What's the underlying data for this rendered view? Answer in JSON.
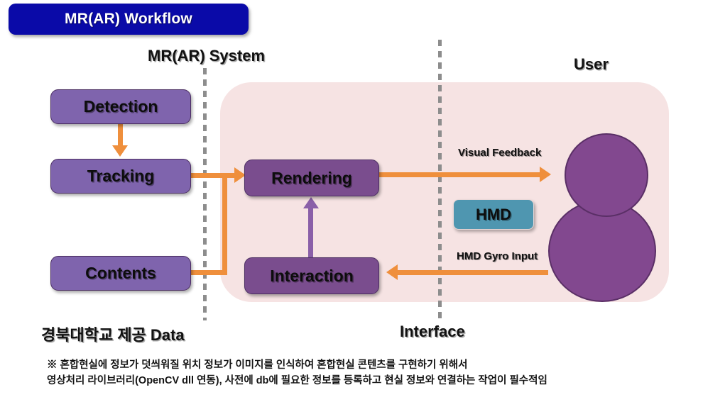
{
  "title": {
    "text": "MR(AR) Workflow",
    "background_color": "#0a0aa8",
    "text_color": "#ffffff"
  },
  "captions": {
    "system": "MR(AR) System",
    "user": "User",
    "data_source": "경북대학교 제공 Data",
    "interface": "Interface"
  },
  "colors": {
    "accent_orange": "#ef8f3c",
    "accent_purple_arrow": "#8a5fa8",
    "box_light_purple": "#7f64ad",
    "box_dark_purple": "#7a4d8e",
    "panel_pink": "#f6e3e3",
    "avatar_purple": "#82488f",
    "hmd_teal": "#4f96b0",
    "divider_gray": "#8d8d8d"
  },
  "boxes": {
    "detection": "Detection",
    "tracking": "Tracking",
    "contents": "Contents",
    "rendering": "Rendering",
    "interaction": "Interaction"
  },
  "hmd": {
    "label": "HMD"
  },
  "flows": {
    "visual_feedback": "Visual Feedback",
    "hmd_gyro_input": "HMD Gyro Input"
  },
  "footer": {
    "note": "※ 혼합현실에 정보가 덧씌워질 위치 정보가 이미지를 인식하여 혼합현실 콘텐츠를 구현하기 위해서\n영상처리 라이브러리(OpenCV dll 연동), 사전에 db에 필요한 정보를 등록하고 현실 정보와 연결하는 작업이 필수적임"
  }
}
